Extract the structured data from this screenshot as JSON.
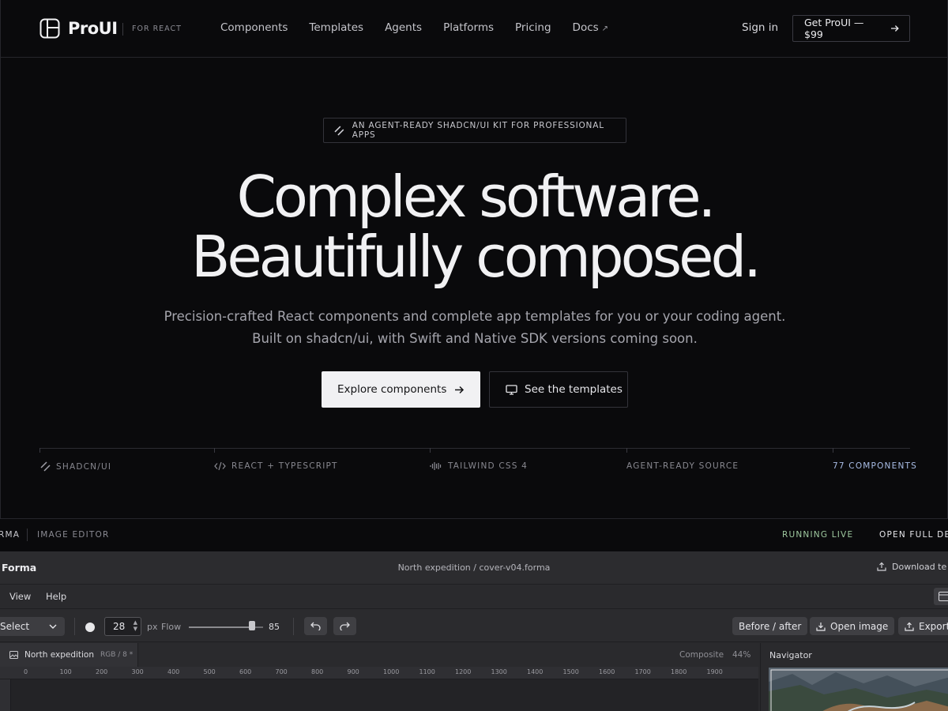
{
  "header": {
    "brand": "ProUI",
    "brand_sub": "FOR REACT",
    "nav": [
      {
        "label": "Components"
      },
      {
        "label": "Templates"
      },
      {
        "label": "Agents"
      },
      {
        "label": "Platforms"
      },
      {
        "label": "Pricing"
      },
      {
        "label": "Docs",
        "external": "↗"
      }
    ],
    "signin": "Sign in",
    "cta": "Get ProUI — $99"
  },
  "hero": {
    "pill": "AN AGENT-READY SHADCN/UI KIT FOR PROFESSIONAL APPS",
    "headline_1": "Complex software.",
    "headline_2": "Beautifully composed.",
    "sub_1": "Precision-crafted React components and complete app templates for you or your coding agent.",
    "sub_2": "Built on shadcn/ui, with Swift and Native SDK versions coming soon.",
    "primary_cta": "Explore components",
    "secondary_cta": "See the templates",
    "features": [
      {
        "label": "SHADCN/UI",
        "icon": "slashes-icon"
      },
      {
        "label": "REACT + TYPESCRIPT",
        "icon": "code-icon"
      },
      {
        "label": "TAILWIND CSS 4",
        "icon": "waveform-icon"
      },
      {
        "label": "AGENT-READY SOURCE",
        "icon": ""
      },
      {
        "label": "77 COMPONENTS",
        "icon": ""
      }
    ]
  },
  "demo_strip": {
    "app": "RMA",
    "section": "IMAGE EDITOR",
    "status": "RUNNING LIVE",
    "open": "OPEN FULL DEM",
    "status_color": "#9fc9a0"
  },
  "editor": {
    "app_name": "Forma",
    "file": "North expedition / cover-v04.forma",
    "download": "Download te",
    "menu": [
      "View",
      "Help"
    ],
    "tool_select": "Select",
    "brush_size": "28",
    "size_unit": "px",
    "flow_label": "Flow",
    "flow_value": "85",
    "flow_fraction": 0.85,
    "before_after": "Before / after",
    "open_image": "Open image",
    "export": "Export",
    "doc_tab": "North expedition",
    "doc_meta": "RGB / 8 *",
    "composite": "Composite",
    "zoom": "44%",
    "navigator": "Navigator",
    "ruler_labels": [
      "0",
      "100",
      "200",
      "300",
      "400",
      "500",
      "600",
      "700",
      "800",
      "900",
      "1000",
      "1100",
      "1200",
      "1300",
      "1400",
      "1500",
      "1600",
      "1700",
      "1800",
      "1900"
    ]
  }
}
